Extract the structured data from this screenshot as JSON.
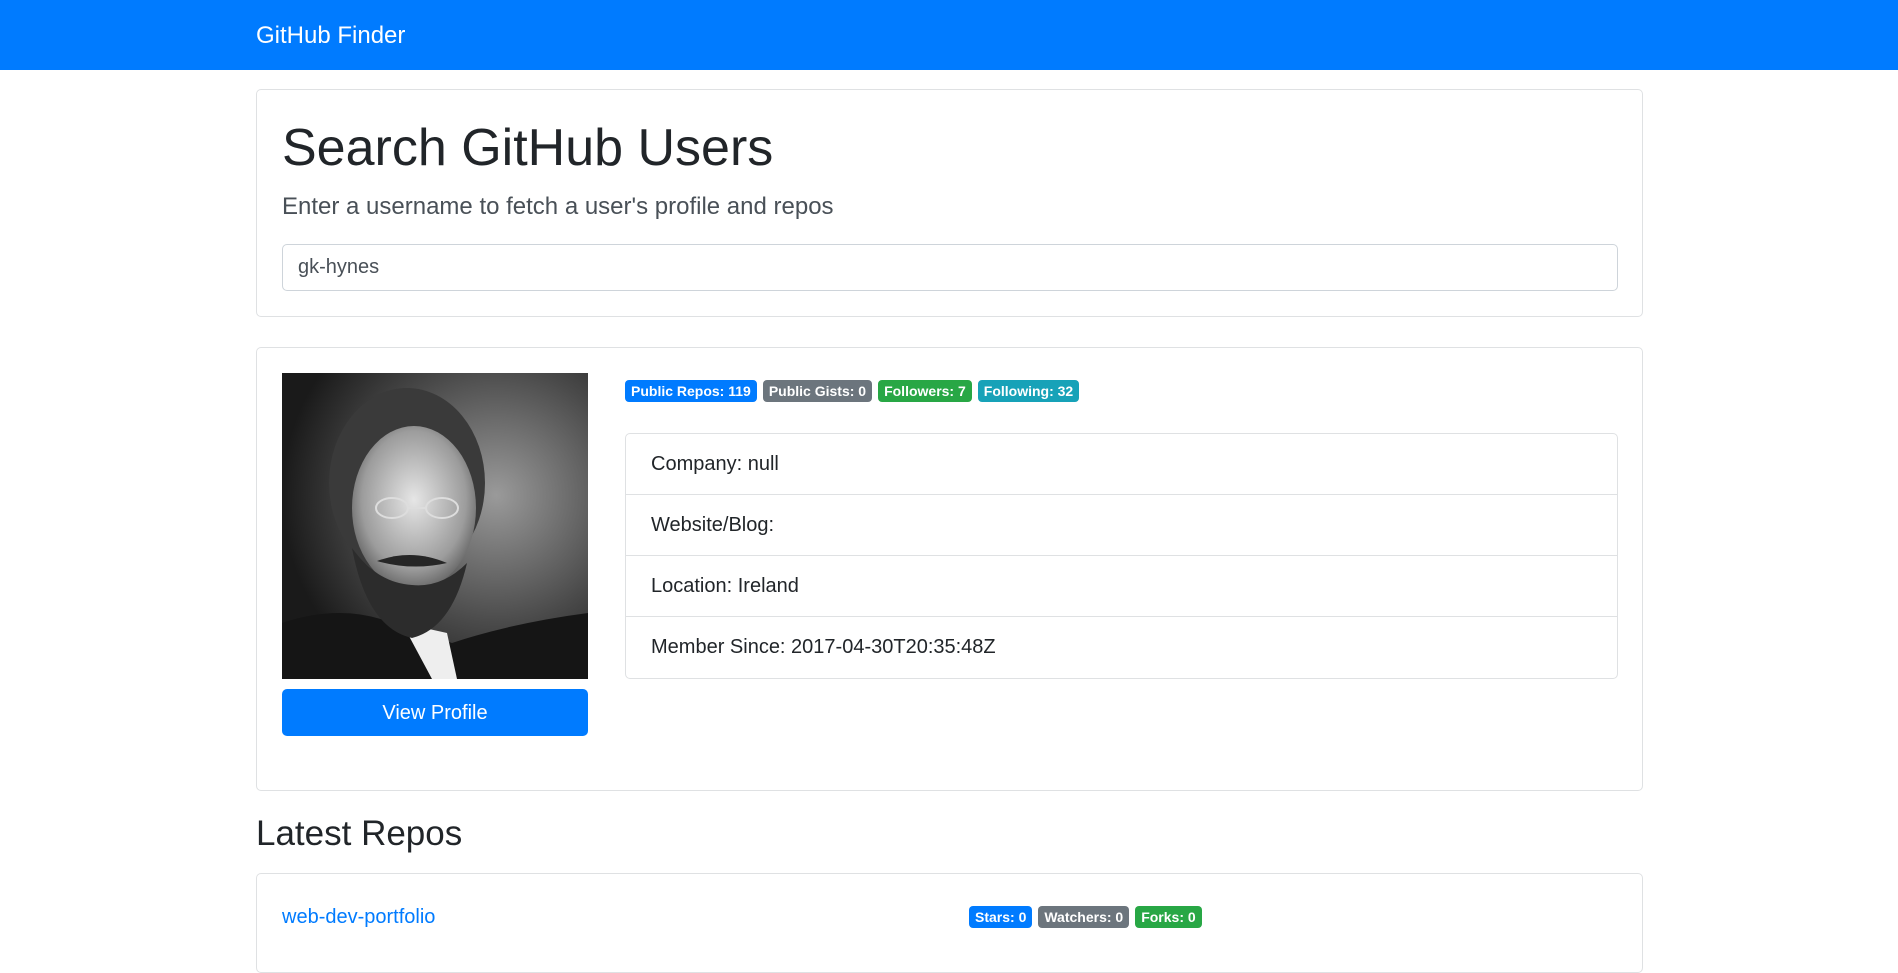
{
  "navbar": {
    "brand": "GitHub Finder"
  },
  "search": {
    "title": "Search GitHub Users",
    "lead": "Enter a username to fetch a user's profile and repos",
    "value": "gk-hynes"
  },
  "profile": {
    "view_profile_label": "View Profile",
    "badges": {
      "public_repos": "Public Repos: 119",
      "public_gists": "Public Gists: 0",
      "followers": "Followers: 7",
      "following": "Following: 32"
    },
    "details": {
      "company": "Company: null",
      "website": "Website/Blog:",
      "location": "Location: Ireland",
      "member_since": "Member Since: 2017-04-30T20:35:48Z"
    }
  },
  "repos": {
    "heading": "Latest Repos",
    "items": [
      {
        "name": "web-dev-portfolio",
        "stars": "Stars: 0",
        "watchers": "Watchers: 0",
        "forks": "Forks: 0"
      }
    ]
  },
  "colors": {
    "primary": "#007bff",
    "secondary": "#6c757d",
    "success": "#28a745",
    "info": "#17a2b8"
  }
}
